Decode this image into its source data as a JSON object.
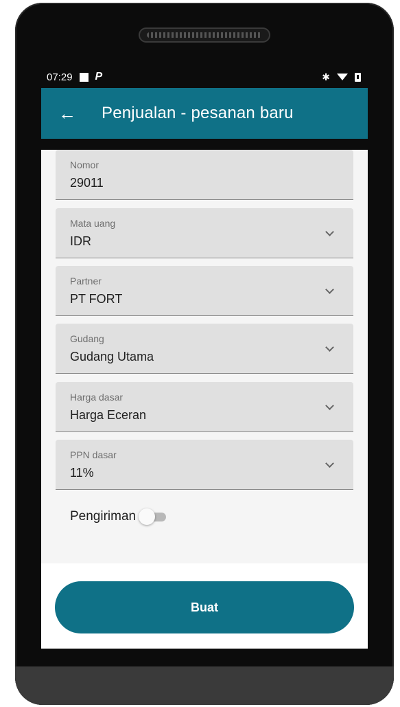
{
  "status_bar": {
    "time": "07:29",
    "app_icon_letter": "P",
    "icons": [
      "notification-square-icon",
      "bluetooth-icon",
      "wifi-icon",
      "battery-icon"
    ]
  },
  "app_bar": {
    "title": "Penjualan - pesanan baru",
    "back_icon": "back-arrow-icon",
    "color": "#0f7187"
  },
  "form": {
    "nomor": {
      "label": "Nomor",
      "value": "29011"
    },
    "mata_uang": {
      "label": "Mata uang",
      "value": "IDR"
    },
    "partner": {
      "label": "Partner",
      "value": "PT FORT"
    },
    "gudang": {
      "label": "Gudang",
      "value": "Gudang Utama"
    },
    "harga_dasar": {
      "label": "Harga dasar",
      "value": "Harga Eceran"
    },
    "ppn_dasar": {
      "label": "PPN dasar",
      "value": "11%"
    },
    "pengiriman": {
      "label": "Pengiriman",
      "enabled": false
    }
  },
  "footer": {
    "submit_label": "Buat"
  }
}
